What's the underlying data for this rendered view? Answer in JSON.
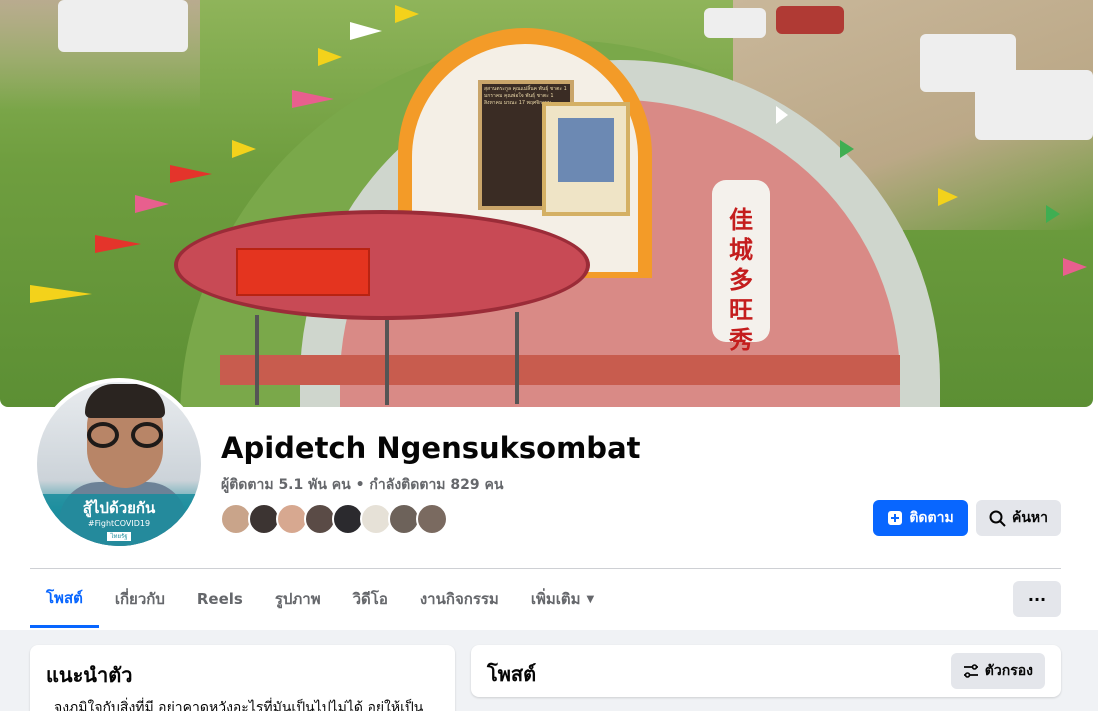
{
  "profile": {
    "name": "Apidetch Ngensuksombat",
    "stats": "ผู้ติดตาม 5.1 พัน คน • กำลังติดตาม 829 คน",
    "avatar_slogan": "สู้ไปด้วยกัน",
    "avatar_hashtag": "#FightCOVID19",
    "avatar_logo": "ไทยรัฐ",
    "follow_button": "ติดตาม",
    "search_button": "ค้นหา",
    "friend_avatar_colors": [
      "#c9a48a",
      "#3c3432",
      "#d7a890",
      "#5a4b46",
      "#2b2a2e",
      "#e6e1d7",
      "#6d625a",
      "#7a6a60"
    ]
  },
  "cover": {
    "plaque_text": "สุสานตระกูล คุณแม่ลิ้นค พันธุ์ ชาตะ 1 มกราคม คุณพ่อใจ พันธุ์ ชาตะ 1 สิงหาคม มรณะ 17 พฤศจิกายน",
    "candle_text": "佳城多旺秀",
    "accent_colors": {
      "marigold": "#f39b28",
      "table_red": "#c84a55",
      "grass": "#6f9e3f"
    }
  },
  "tabs": [
    {
      "label": "โพสต์",
      "active": true
    },
    {
      "label": "เกี่ยวกับ",
      "active": false
    },
    {
      "label": "Reels",
      "active": false
    },
    {
      "label": "รูปภาพ",
      "active": false
    },
    {
      "label": "วิดีโอ",
      "active": false
    },
    {
      "label": "งานกิจกรรม",
      "active": false
    },
    {
      "label": "เพิ่มเติม",
      "active": false
    }
  ],
  "more_button": "···",
  "intro": {
    "title": "แนะนำตัว",
    "text": "จงภูมิใจกับสิ่งที่มี อย่าคาดหวังอะไรที่มันเป็นไปไม่ได้ อยู่ให้เป็น"
  },
  "posts": {
    "title": "โพสต์",
    "filter_button": "ตัวกรอง"
  },
  "colors": {
    "primary": "#0866ff",
    "secondary_button": "#e4e6eb",
    "muted_text": "#65676b",
    "page_bg": "#f0f2f5"
  }
}
